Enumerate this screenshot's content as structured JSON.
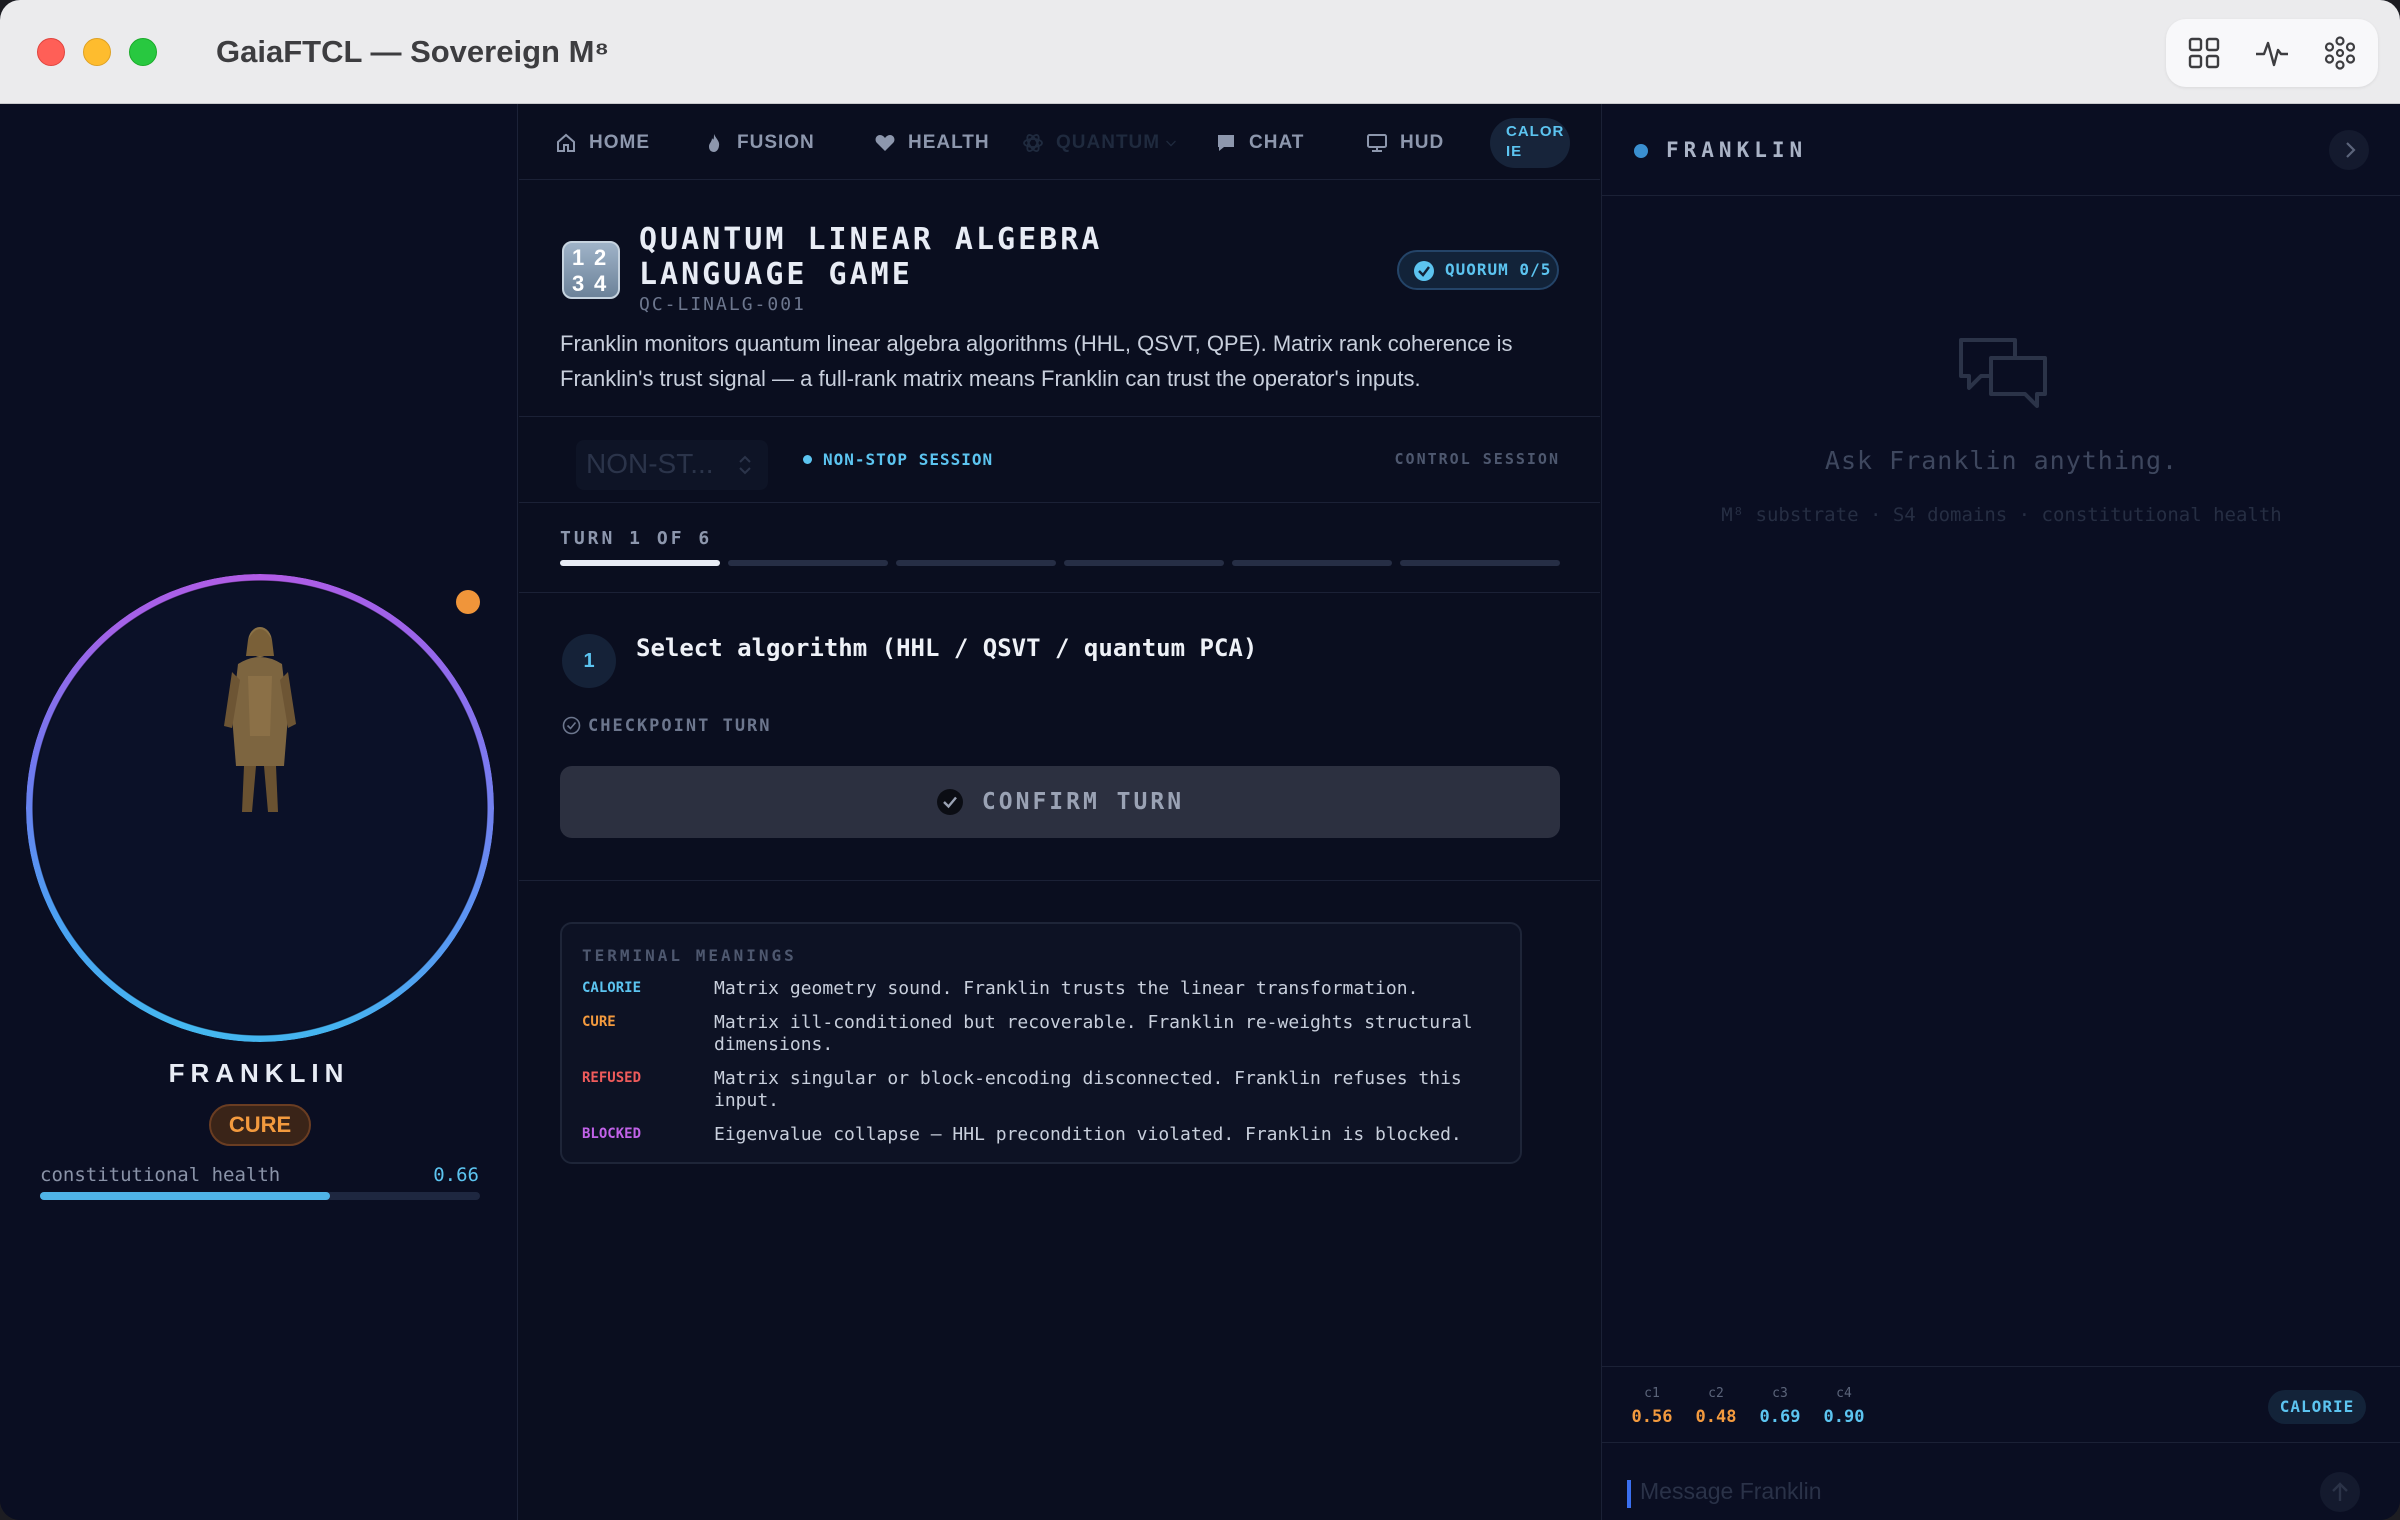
{
  "window": {
    "title": "GaiaFTCL — Sovereign M⁸"
  },
  "titlebar_icons": [
    "grid-icon",
    "pulse-icon",
    "atom-icon"
  ],
  "avatar_panel": {
    "name": "FRANKLIN",
    "state_badge": "CURE",
    "health_label": "constitutional health",
    "health_value": "0.66",
    "health_fraction": 0.66,
    "status_dot_color": "#f0953a"
  },
  "nav": {
    "items": [
      {
        "label": "HOME",
        "icon": "home-icon"
      },
      {
        "label": "FUSION",
        "icon": "flame-icon"
      },
      {
        "label": "HEALTH",
        "icon": "heart-icon"
      },
      {
        "label": "QUANTUM",
        "icon": "atom-icon"
      },
      {
        "label": "CHAT",
        "icon": "chat-icon"
      },
      {
        "label": "HUD",
        "icon": "monitor-icon"
      }
    ],
    "calorie_pill": "CALOR IE"
  },
  "game": {
    "icon_digits": [
      "1",
      "2",
      "3",
      "4"
    ],
    "title": "QUANTUM LINEAR ALGEBRA LANGUAGE GAME",
    "code": "QC-LINALG-001",
    "quorum": "QUORUM 0/5",
    "description": "Franklin monitors quantum linear algebra algorithms (HHL, QSVT, QPE). Matrix rank coherence is Franklin's trust signal — a full-rank matrix means Franklin can trust the operator's inputs."
  },
  "session": {
    "mode_select_value": "NON-ST...",
    "status": "NON-STOP SESSION",
    "control_label": "CONTROL SESSION"
  },
  "progress": {
    "label": "TURN 1 OF 6",
    "current_turn": 1,
    "total_turns": 6
  },
  "step": {
    "number": "1",
    "text": "Select algorithm (HHL / QSVT / quantum PCA)",
    "checkpoint_label": "CHECKPOINT TURN",
    "confirm_label": "CONFIRM TURN"
  },
  "terminal": {
    "title": "TERMINAL MEANINGS",
    "rows": [
      {
        "key": "CALORIE",
        "color": "#5cc4f0",
        "text": "Matrix geometry sound. Franklin trusts the linear transformation."
      },
      {
        "key": "CURE",
        "color": "#f39a3e",
        "text": "Matrix ill-conditioned but recoverable. Franklin re-weights structural dimensions."
      },
      {
        "key": "REFUSED",
        "color": "#ef5b5b",
        "text": "Matrix singular or block-encoding disconnected. Franklin refuses this input."
      },
      {
        "key": "BLOCKED",
        "color": "#c162e8",
        "text": "Eigenvalue collapse — HHL precondition violated. Franklin is blocked."
      }
    ]
  },
  "chat_panel": {
    "title": "FRANKLIN",
    "empty_title": "Ask Franklin anything.",
    "empty_subtitle": "M⁸ substrate · S4 domains · constitutional health",
    "metrics": [
      {
        "key": "c1",
        "value": "0.56",
        "color": "#f39a3e"
      },
      {
        "key": "c2",
        "value": "0.48",
        "color": "#f39a3e"
      },
      {
        "key": "c3",
        "value": "0.69",
        "color": "#5cc4f0"
      },
      {
        "key": "c4",
        "value": "0.90",
        "color": "#5cc4f0"
      }
    ],
    "status_badge": "CALORIE",
    "input_placeholder": "Message Franklin"
  }
}
